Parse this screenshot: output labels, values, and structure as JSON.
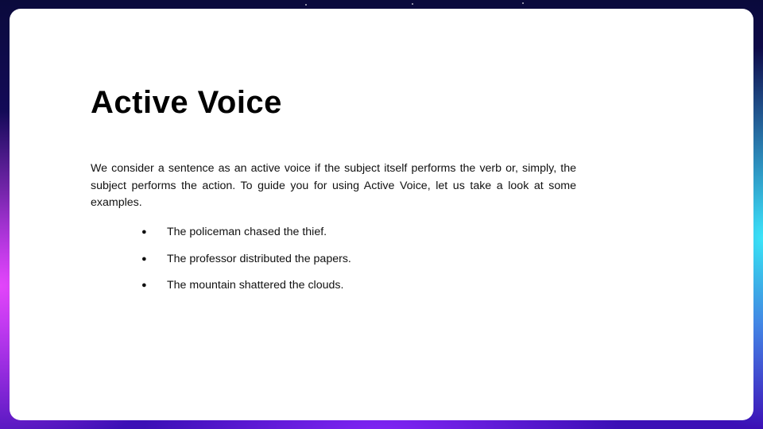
{
  "slide": {
    "title": "Active Voice",
    "body": "We consider a sentence as an active voice if the subject itself performs the verb or, simply, the subject performs the action. To guide you for using Active Voice, let us take a look at some examples.",
    "examples": [
      "The policeman chased the thief.",
      "The professor distributed the papers.",
      "The mountain shattered the clouds."
    ],
    "bullet_glyph": "●"
  },
  "colors": {
    "card_background": "#ffffff",
    "text": "#111111",
    "frame_gradient_top": "#0a0a3c",
    "frame_gradient_bottom": "#4a12c8",
    "frame_accent_left": "#ec48ff",
    "frame_accent_right": "#3cf0ff"
  }
}
